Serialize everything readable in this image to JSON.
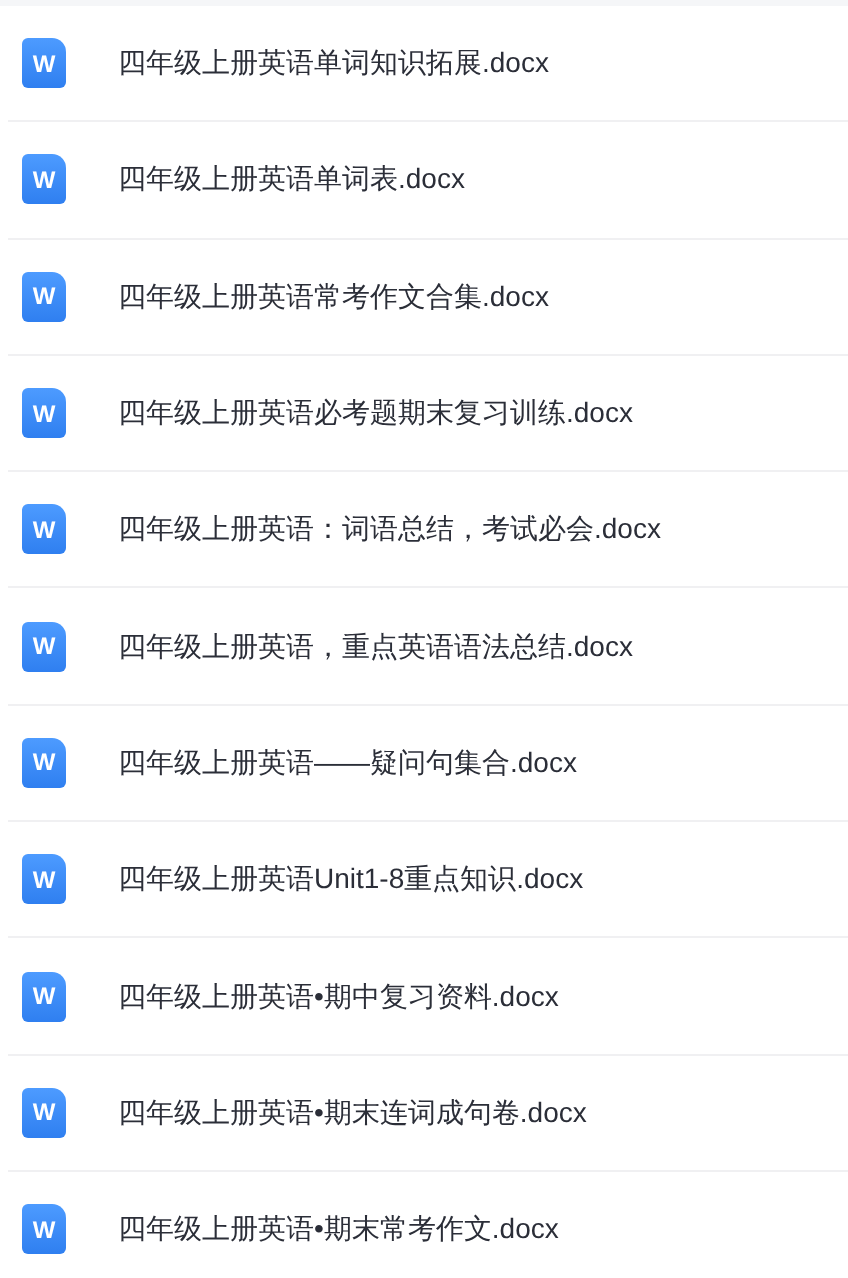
{
  "files": [
    {
      "name": "四年级上册英语单词知识拓展.docx",
      "icon_letter": "W"
    },
    {
      "name": "四年级上册英语单词表.docx",
      "icon_letter": "W"
    },
    {
      "name": "四年级上册英语常考作文合集.docx",
      "icon_letter": "W"
    },
    {
      "name": "四年级上册英语必考题期末复习训练.docx",
      "icon_letter": "W"
    },
    {
      "name": "四年级上册英语：词语总结，考试必会.docx",
      "icon_letter": "W"
    },
    {
      "name": "四年级上册英语，重点英语语法总结.docx",
      "icon_letter": "W"
    },
    {
      "name": "四年级上册英语——疑问句集合.docx",
      "icon_letter": "W"
    },
    {
      "name": "四年级上册英语Unit1-8重点知识.docx",
      "icon_letter": "W"
    },
    {
      "name": "四年级上册英语•期中复习资料.docx",
      "icon_letter": "W"
    },
    {
      "name": "四年级上册英语•期末连词成句卷.docx",
      "icon_letter": "W"
    },
    {
      "name": "四年级上册英语•期末常考作文.docx",
      "icon_letter": "W"
    }
  ]
}
